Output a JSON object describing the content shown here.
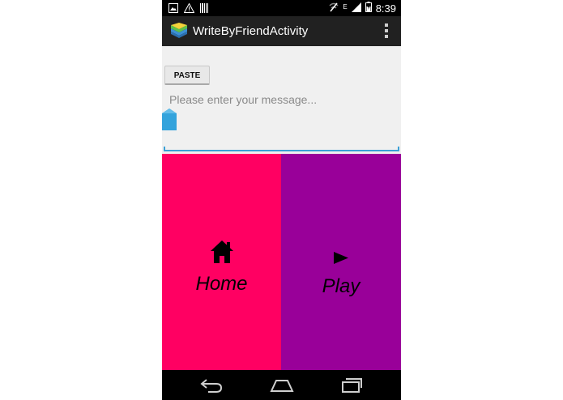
{
  "status_bar": {
    "time": "8:39",
    "network_label": "E"
  },
  "action_bar": {
    "title": "WriteByFriendActivity"
  },
  "content": {
    "paste_label": "PASTE",
    "message_placeholder": "Please enter your message..."
  },
  "tiles": {
    "home_label": "Home",
    "play_label": "Play"
  },
  "colors": {
    "home_tile": "#ff0062",
    "play_tile": "#990099",
    "accent": "#3aa0d6",
    "action_bar": "#212121"
  },
  "icons": [
    "picture-icon",
    "warning-icon",
    "barcode-icon",
    "no-wifi-icon",
    "signal-icon",
    "battery-icon",
    "app-icon",
    "overflow-menu-icon",
    "house-icon",
    "play-triangle-icon",
    "back-icon",
    "home-nav-icon",
    "recent-apps-icon"
  ]
}
